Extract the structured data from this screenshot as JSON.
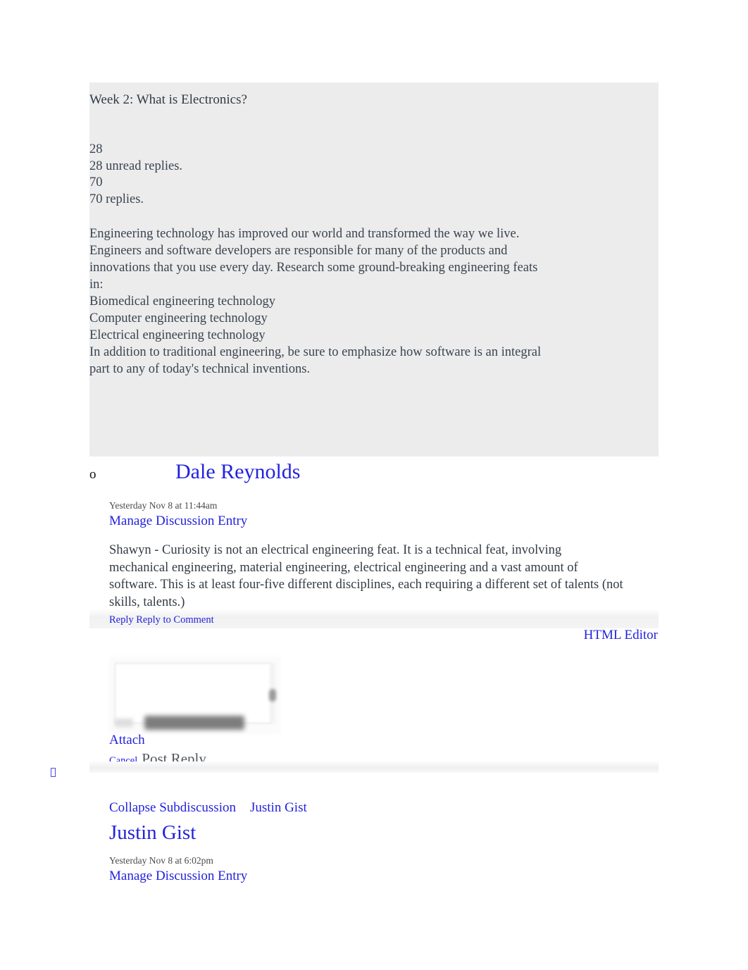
{
  "topic": {
    "title": "Week 2: What is Electronics?",
    "unread_count": "28",
    "unread_label": "28 unread replies.",
    "replies_count": "70",
    "replies_label": "70 replies.",
    "body_lines": [
      "Engineering technology has improved our world and transformed the way we live.",
      "Engineers and software developers are responsible for many of the products and",
      "innovations that you use every day. Research some ground-breaking engineering feats",
      "in:",
      "Biomedical engineering technology",
      "Computer engineering technology",
      "Electrical engineering technology",
      "In addition to traditional engineering, be sure to emphasize how software is an integral",
      "part to any of today's technical inventions."
    ]
  },
  "entries": [
    {
      "bullet": "o",
      "author": "Dale Reynolds",
      "timestamp": "Yesterday Nov 8 at 11:44am",
      "manage_label": "Manage Discussion Entry",
      "message": "Shawyn - Curiosity is not an electrical engineering feat. It is a technical feat, involving mechanical engineering, material engineering, electrical engineering and a vast amount of software. This is at least four-five different disciplines, each requiring a different set of talents (not skills, talents.)",
      "reply_label": "Reply",
      "reply_to_comment_label": "Reply to Comment"
    }
  ],
  "editor": {
    "html_editor_label": "HTML Editor",
    "textarea_value": "",
    "textarea_placeholder": "",
    "attach_label": "Attach",
    "cancel_label": "Cancel",
    "post_reply_label": "Post Reply"
  },
  "subdiscussion": {
    "collapse_label": "Collapse Subdiscussion",
    "name_link": "Justin Gist",
    "author": "Justin Gist",
    "timestamp": "Yesterday Nov 8 at 6:02pm",
    "manage_label": "Manage Discussion Entry"
  },
  "icons": {
    "missing_glyph": "missing-glyph-box"
  },
  "colors": {
    "link_blue": "#2222dd",
    "panel_gray": "#ececec",
    "body_text": "#3a4450",
    "post_reply_gray": "#52585e"
  }
}
